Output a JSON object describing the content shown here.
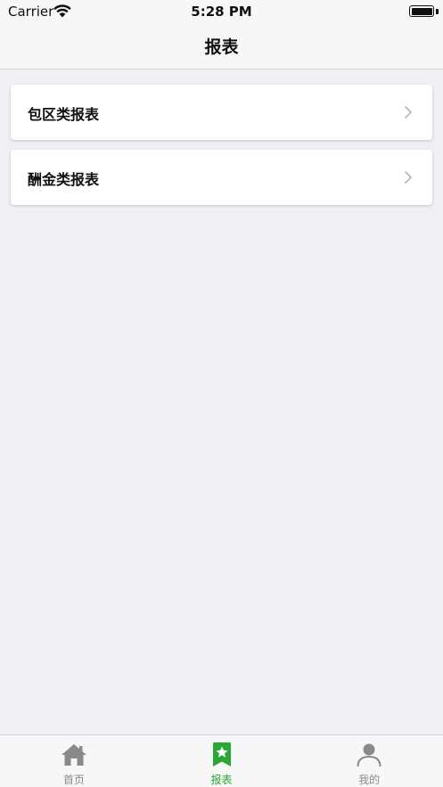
{
  "status_bar": {
    "carrier": "Carrier",
    "time": "5:28 PM"
  },
  "nav": {
    "title": "报表"
  },
  "list": {
    "items": [
      {
        "label": "包区类报表"
      },
      {
        "label": "酬金类报表"
      }
    ]
  },
  "tab_bar": {
    "tabs": [
      {
        "label": "首页",
        "icon": "home-icon",
        "active": false
      },
      {
        "label": "报表",
        "icon": "report-bookmark-star-icon",
        "active": true
      },
      {
        "label": "我的",
        "icon": "user-icon",
        "active": false
      }
    ],
    "active_color": "#29a934",
    "inactive_color": "#8a8a8a"
  }
}
